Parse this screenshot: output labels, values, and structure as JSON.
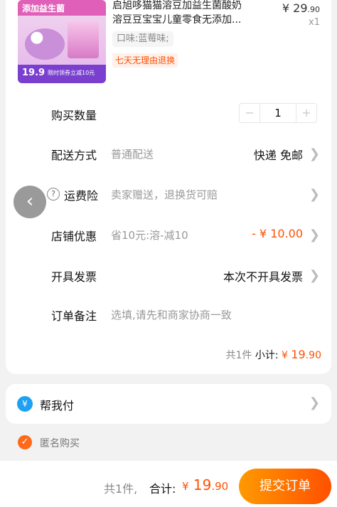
{
  "product": {
    "title_line1": "启旭哆猫猫溶豆加益生菌酸奶",
    "title_line2": "溶豆豆宝宝儿童零食无添加...",
    "sku": "口味:蓝莓味;",
    "tag": "七天无理由退换",
    "price_currency": "¥",
    "price_int": "29",
    "price_dec": ".90",
    "qty_x": "x1",
    "image": {
      "banner": "添加益生菌",
      "price": "19.9",
      "promo": "限时领券立减10元"
    }
  },
  "rows": {
    "qty": {
      "label": "购买数量",
      "minus": "−",
      "value": "1",
      "plus": "+"
    },
    "delivery": {
      "label": "配送方式",
      "value": "普通配送",
      "right": "快递 免邮"
    },
    "insurance": {
      "label": "运费险",
      "value": "卖家赠送，退换货可赔",
      "help": "?"
    },
    "discount": {
      "label": "店铺优惠",
      "value": "省10元:溶-减10",
      "right": "- ¥ 10.00"
    },
    "invoice": {
      "label": "开具发票",
      "right": "本次不开具发票"
    },
    "note": {
      "label": "订单备注",
      "placeholder": "选填,请先和商家协商一致"
    }
  },
  "subtotal": {
    "count": "共1件",
    "label": "小计:",
    "currency": "¥",
    "int": "19",
    "dec": ".90"
  },
  "pay_for_me": {
    "icon": "¥",
    "label": "帮我付"
  },
  "anonymous": {
    "label": "匿名购买"
  },
  "bottom": {
    "count": "共1件,",
    "label": "合计:",
    "currency": "¥",
    "int": "19",
    "dec": ".90",
    "submit": "提交订单"
  },
  "colors": {
    "accent": "#ff5000",
    "button_start": "#ff9a00",
    "pay_icon": "#1da1f2"
  },
  "icons": [
    "chevron-right-icon",
    "back-icon",
    "help-icon",
    "pay-icon",
    "check-icon"
  ]
}
